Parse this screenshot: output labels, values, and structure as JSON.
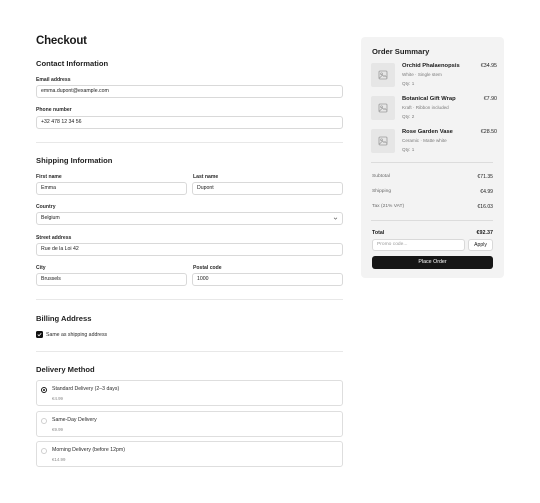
{
  "page": {
    "title": "Checkout"
  },
  "contact": {
    "title": "Contact Information",
    "email_label": "Email address",
    "email_value": "emma.dupont@example.com",
    "phone_label": "Phone number",
    "phone_value": "+32 478 12 34 56"
  },
  "shipping": {
    "title": "Shipping Information",
    "first_name_label": "First name",
    "first_name_value": "Emma",
    "last_name_label": "Last name",
    "last_name_value": "Dupont",
    "country_label": "Country",
    "country_value": "Belgium",
    "street_label": "Street address",
    "street_value": "Rue de la Loi 42",
    "city_label": "City",
    "city_value": "Brussels",
    "postal_label": "Postal code",
    "postal_value": "1000"
  },
  "billing": {
    "title": "Billing Address",
    "same_as_shipping_label": "Same as shipping address",
    "same_as_shipping_checked": true
  },
  "delivery": {
    "title": "Delivery Method",
    "options": [
      {
        "name": "Standard Delivery (2–3 days)",
        "price": "€4.99",
        "selected": true
      },
      {
        "name": "Same-Day Delivery",
        "price": "€9.99",
        "selected": false
      },
      {
        "name": "Morning Delivery (before 12pm)",
        "price": "€14.99",
        "selected": false
      }
    ]
  },
  "summary": {
    "title": "Order Summary",
    "items": [
      {
        "name": "Orchid Phalaenopsis",
        "meta": "White · Single stem",
        "qty": "Qty: 1",
        "price": "€34.95"
      },
      {
        "name": "Botanical Gift Wrap",
        "meta": "Kraft · Ribbon included",
        "qty": "Qty: 2",
        "price": "€7.90"
      },
      {
        "name": "Rose Garden Vase",
        "meta": "Ceramic · Matte white",
        "qty": "Qty: 1",
        "price": "€28.50"
      }
    ],
    "subtotal_label": "Subtotal",
    "subtotal_value": "€71.35",
    "shipping_label": "Shipping",
    "shipping_value": "€4.99",
    "tax_label": "Tax (21% VAT)",
    "tax_value": "€16.03",
    "total_label": "Total",
    "total_value": "€92.37",
    "promo_placeholder": "Promo code...",
    "apply_label": "Apply",
    "place_order_label": "Place Order"
  },
  "icons": {
    "item_thumbnail": "image-placeholder-icon",
    "select_chevron": "chevron-down-icon",
    "checkbox": "checkmark-icon"
  },
  "colors": {
    "primary_button": "#161616",
    "panel_bg": "#f3f3f3",
    "border": "#d9d9d9"
  }
}
